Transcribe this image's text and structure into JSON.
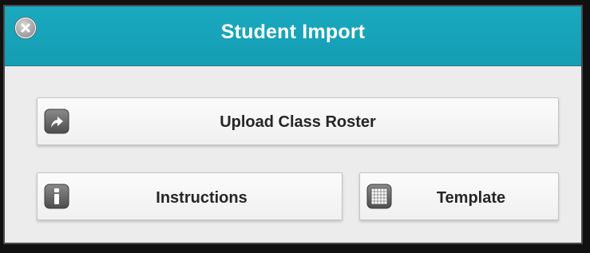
{
  "dialog": {
    "title": "Student Import",
    "close_icon": "close-icon",
    "accent_color": "#18a4ba"
  },
  "buttons": {
    "upload": {
      "label": "Upload Class Roster",
      "icon": "upload-arrow-icon"
    },
    "instructions": {
      "label": "Instructions",
      "icon": "info-icon"
    },
    "template": {
      "label": "Template",
      "icon": "grid-icon"
    }
  }
}
